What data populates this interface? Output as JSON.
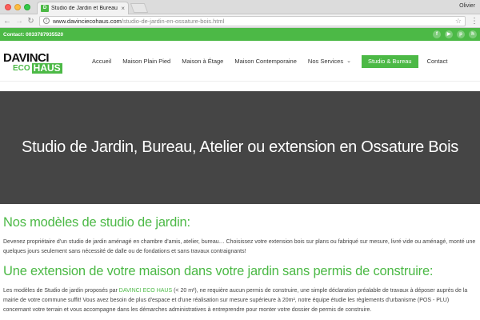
{
  "browser": {
    "tab_title": "Studio de Jardin et Bureau en",
    "profile_name": "Olivier",
    "url_host": "www.davinciecohaus.com",
    "url_path": "/studio-de-jardin-en-ossature-bois.html",
    "favicon_text": "D"
  },
  "site": {
    "contact": "Contact: 0033787935520",
    "social_icons": [
      "facebook-icon",
      "youtube-icon",
      "pinterest-icon",
      "houzz-icon"
    ],
    "logo": {
      "line1": "DAVINCI",
      "eco": "ECO",
      "haus": "HAUS"
    },
    "menu": [
      "Accueil",
      "Maison Plain Pied",
      "Maison à Étage",
      "Maison Contemporaine",
      "Nos Services",
      "Studio & Bureau",
      "Contact"
    ],
    "hero_title": "Studio de Jardin, Bureau, Atelier ou extension en Ossature Bois",
    "section1": {
      "heading": "Nos modèles de studio de jardin:",
      "text": "Devenez propriétaire d'un studio de jardin aménagé en chambre d'amis, atelier, bureau… Choisissez votre extension bois sur plans ou fabriqué sur mesure, livré vide ou aménagé, monté une quelques jours seulement sans nécessité de dalle ou de fondations et sans travaux contraignants!"
    },
    "section2": {
      "heading": "Une extension de votre maison dans votre jardin sans permis de construire:",
      "text_before": "Les modèles de Studio de jardin proposés par ",
      "link": "DAVINCI ECO HAUS",
      "text_after": " (< 20 m²), ne requière aucun permis de construire, une simple déclaration préalable de travaux à déposer auprès de la mairie de votre commune suffit! Vous avez besoin de plus d'espace et d'une réalisation sur mesure supérieure à 20m², notre équipe étudie les règlements d'urbanisme (POS - PLU) concernant votre terrain et vous accompagne dans les démarches administratives à entreprendre pour monter votre dossier de permis de construire."
    }
  },
  "colors": {
    "brand_green": "#4cb946",
    "hero_bg": "#454545"
  }
}
